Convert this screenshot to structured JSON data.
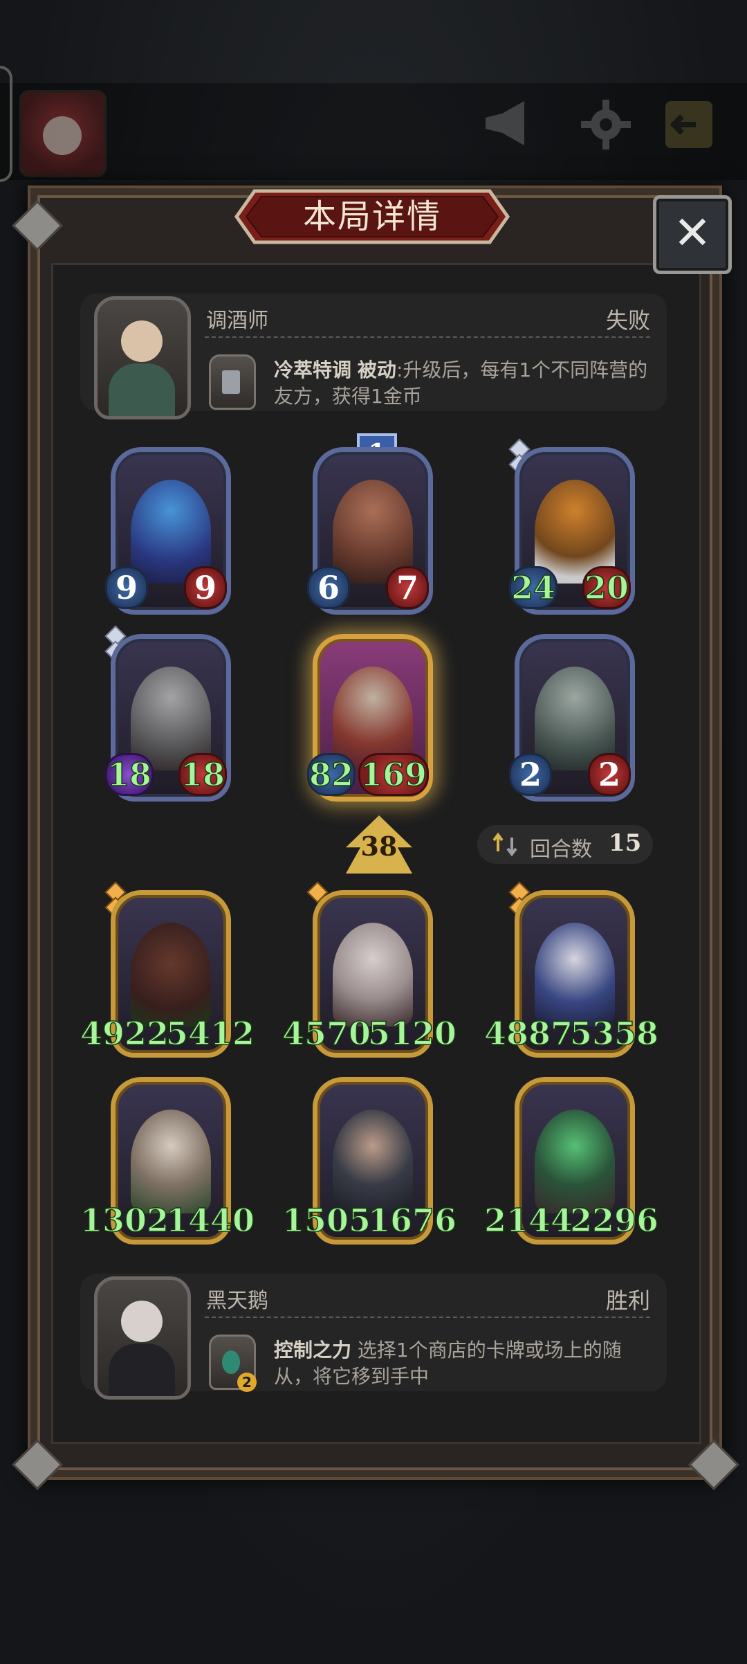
{
  "title": "本局详情",
  "close_icon": "close-icon",
  "top_hero": {
    "name": "调酒师",
    "result": "失败",
    "skill_name": "冷萃特调",
    "skill_type": "被动",
    "skill_desc": ":升级后，每有1个不同阵营的友方，获得1金币"
  },
  "bottom_hero": {
    "name": "黑天鹅",
    "result": "胜利",
    "skill_name": "控制之力",
    "skill_desc": " 选择1个商店的卡牌或场上的随从，将它移到手中",
    "skill_badge": "2"
  },
  "top_board": {
    "tier_tag": "1",
    "row1": [
      {
        "atk": "9",
        "hp": "9"
      },
      {
        "atk": "6",
        "hp": "7"
      },
      {
        "atk": "24",
        "hp": "20"
      }
    ],
    "row2": [
      {
        "atk": "18",
        "hp": "18"
      },
      {
        "atk": "82",
        "hp": "169"
      },
      {
        "atk": "2",
        "hp": "2"
      }
    ]
  },
  "level_value": "38",
  "rounds": {
    "label": "回合数",
    "value": "15"
  },
  "bottom_board": {
    "row1": [
      {
        "atk": "4922",
        "hp": "5412"
      },
      {
        "atk": "4570",
        "hp": "5120"
      },
      {
        "atk": "4887",
        "hp": "5358"
      }
    ],
    "row2": [
      {
        "atk": "1302",
        "hp": "1440"
      },
      {
        "atk": "1505",
        "hp": "1676"
      },
      {
        "atk": "2144",
        "hp": "2296"
      }
    ]
  },
  "colors": {
    "buff_green": "#a7f59a",
    "frame_blue": "#5b6a9a",
    "frame_gold": "#c69a3a"
  }
}
